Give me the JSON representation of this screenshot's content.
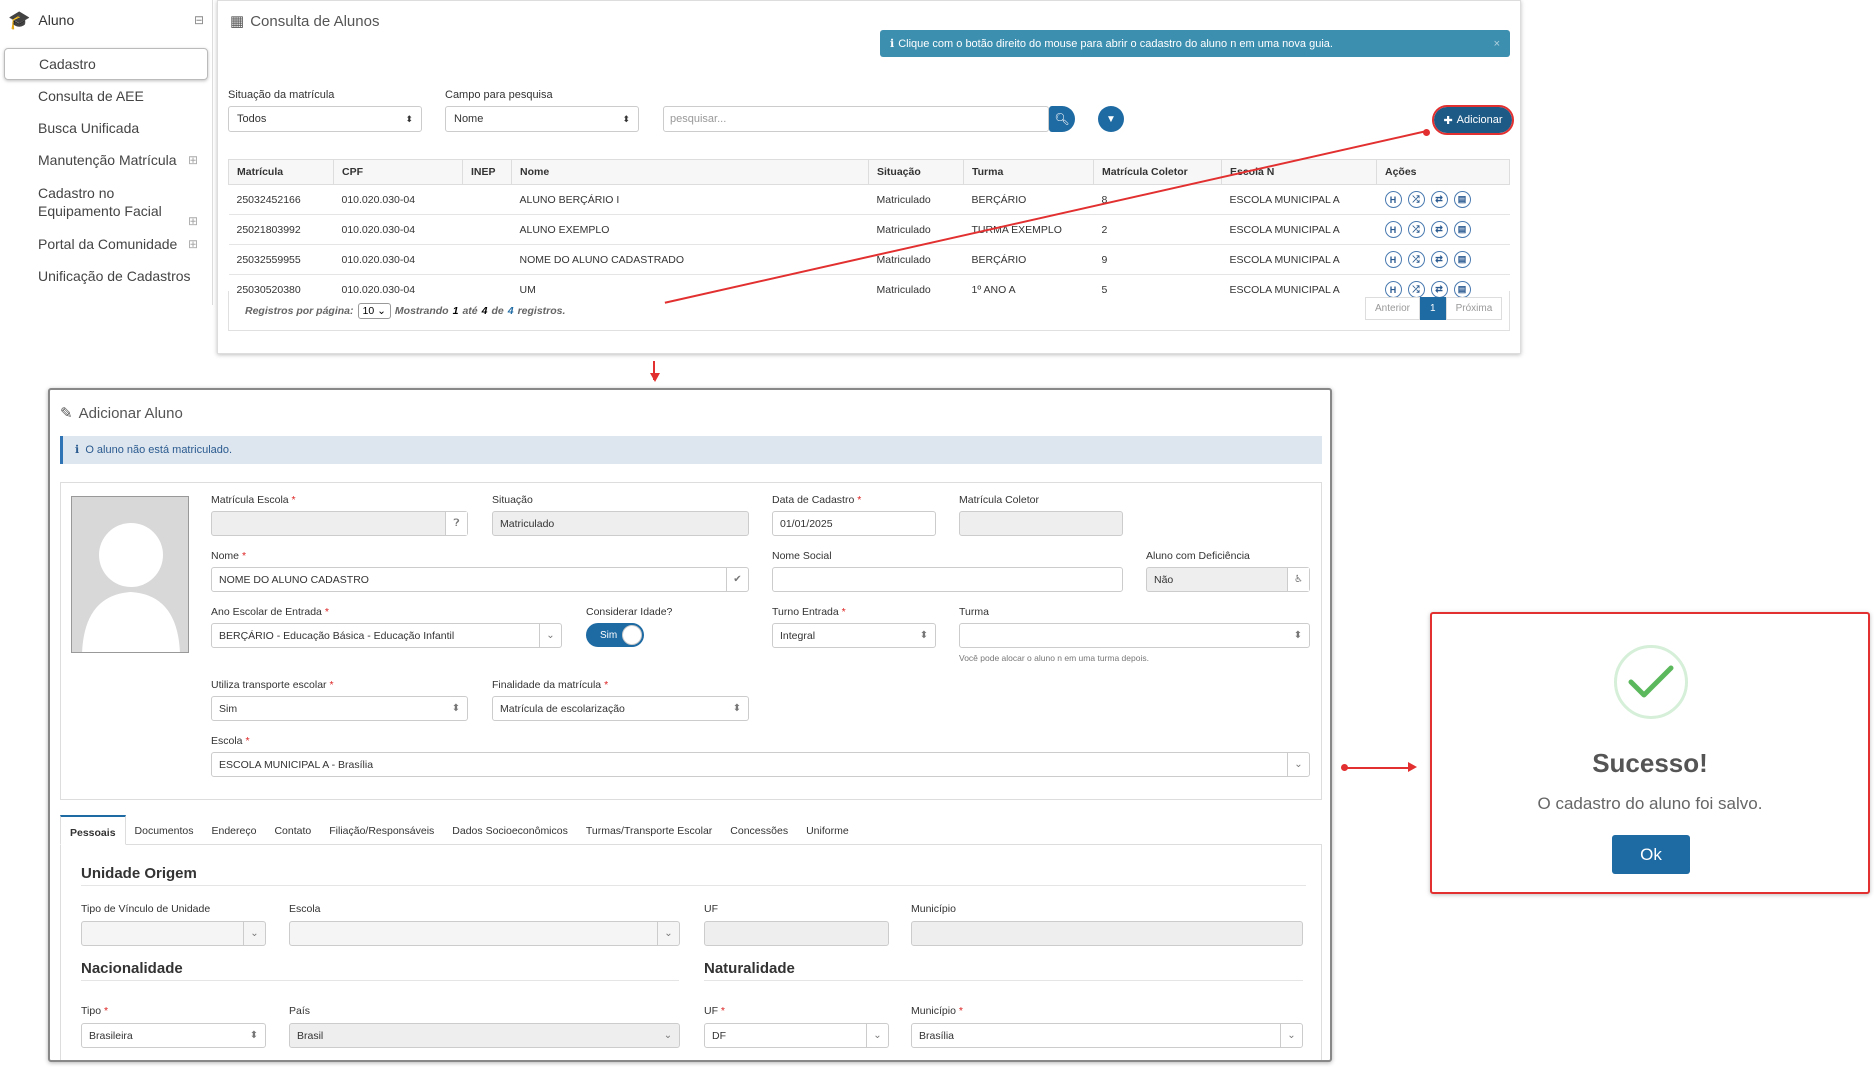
{
  "sidebar": {
    "title": "Aluno",
    "items": [
      {
        "label": "Cadastro"
      },
      {
        "label": "Consulta de AEE"
      },
      {
        "label": "Busca Unificada"
      },
      {
        "label": "Manutenção Matrícula"
      },
      {
        "label": "Cadastro no Equipamento Facial"
      },
      {
        "label": "Portal da Comunidade"
      },
      {
        "label": "Unificação de Cadastros"
      }
    ]
  },
  "consulta": {
    "title": "Consulta de Alunos",
    "alert": "Clique com o botão direito do mouse para abrir o cadastro do aluno n em uma nova guia.",
    "situacao_label": "Situação da matrícula",
    "situacao_value": "Todos",
    "campo_label": "Campo para pesquisa",
    "campo_value": "Nome",
    "search_placeholder": "pesquisar...",
    "add_label": "Adicionar",
    "columns": [
      "Matrícula",
      "CPF",
      "INEP",
      "Nome",
      "Situação",
      "Turma",
      "Matrícula Coletor",
      "Escola N",
      "Ações"
    ],
    "rows": [
      {
        "matricula": "25032452166",
        "cpf": "010.020.030-04",
        "inep": "",
        "nome": "ALUNO BERÇÁRIO I",
        "situacao": "Matriculado",
        "turma": "BERÇÁRIO",
        "coletor": "8",
        "escola": "ESCOLA MUNICIPAL A"
      },
      {
        "matricula": "25021803992",
        "cpf": "010.020.030-04",
        "inep": "",
        "nome": "ALUNO EXEMPLO",
        "situacao": "Matriculado",
        "turma": "TURMA EXEMPLO",
        "coletor": "2",
        "escola": "ESCOLA MUNICIPAL A"
      },
      {
        "matricula": "25032559955",
        "cpf": "010.020.030-04",
        "inep": "",
        "nome": "NOME DO ALUNO CADASTRADO",
        "situacao": "Matriculado",
        "turma": "BERÇÁRIO",
        "coletor": "9",
        "escola": "ESCOLA MUNICIPAL A"
      },
      {
        "matricula": "25030520380",
        "cpf": "010.020.030-04",
        "inep": "",
        "nome": "UM",
        "situacao": "Matriculado",
        "turma": "1º ANO A",
        "coletor": "5",
        "escola": "ESCOLA MUNICIPAL A"
      }
    ],
    "footer_prefix": "Registros por página:",
    "per_page": "10",
    "footer_text_1": "Mostrando",
    "footer_from": "1",
    "footer_text_2": "até",
    "footer_to": "4",
    "footer_text_3": "de",
    "footer_total": "4",
    "footer_text_4": "registros.",
    "pager": {
      "prev": "Anterior",
      "current": "1",
      "next": "Próxima"
    }
  },
  "form": {
    "title": "Adicionar Aluno",
    "info": "O aluno não está matriculado.",
    "matricula_escola_label": "Matrícula Escola",
    "situacao_label": "Situação",
    "situacao_value": "Matriculado",
    "data_cadastro_label": "Data de Cadastro",
    "data_cadastro_value": "01/01/2025",
    "matricula_coletor_label": "Matrícula Coletor",
    "nome_label": "Nome",
    "nome_value": "NOME DO ALUNO CADASTRO",
    "nome_social_label": "Nome Social",
    "deficiencia_label": "Aluno com Deficiência",
    "deficiencia_value": "Não",
    "ano_label": "Ano Escolar de Entrada",
    "ano_value": "BERÇÁRIO - Educação Básica - Educação Infantil",
    "idade_label": "Considerar Idade?",
    "idade_value": "Sim",
    "turno_label": "Turno Entrada",
    "turno_value": "Integral",
    "turma_label": "Turma",
    "turma_hint": "Você pode alocar o aluno n em uma turma depois.",
    "transporte_label": "Utiliza transporte escolar",
    "transporte_value": "Sim",
    "finalidade_label": "Finalidade da matrícula",
    "finalidade_value": "Matrícula de escolarização",
    "escola_label": "Escola",
    "escola_value": "ESCOLA MUNICIPAL A - Brasília",
    "tabs": [
      "Pessoais",
      "Documentos",
      "Endereço",
      "Contato",
      "Filiação/Responsáveis",
      "Dados Socioeconômicos",
      "Turmas/Transporte Escolar",
      "Concessões",
      "Uniforme"
    ],
    "unidade_origem": "Unidade Origem",
    "tipo_vinculo_label": "Tipo de Vínculo de Unidade",
    "escola2_label": "Escola",
    "uf_label": "UF",
    "municipio_label": "Município",
    "nacionalidade": "Nacionalidade",
    "naturalidade": "Naturalidade",
    "tipo_label": "Tipo",
    "tipo_value": "Brasileira",
    "pais_label": "País",
    "pais_value": "Brasil",
    "uf2_label": "UF",
    "uf2_value": "DF",
    "municipio2_label": "Município",
    "municipio2_value": "Brasília"
  },
  "modal": {
    "title": "Sucesso!",
    "message": "O cadastro do aluno foi salvo.",
    "ok_label": "Ok"
  },
  "colors": {
    "primary": "#1e6aa3",
    "highlight": "#e23030",
    "success": "#5cb85c"
  }
}
